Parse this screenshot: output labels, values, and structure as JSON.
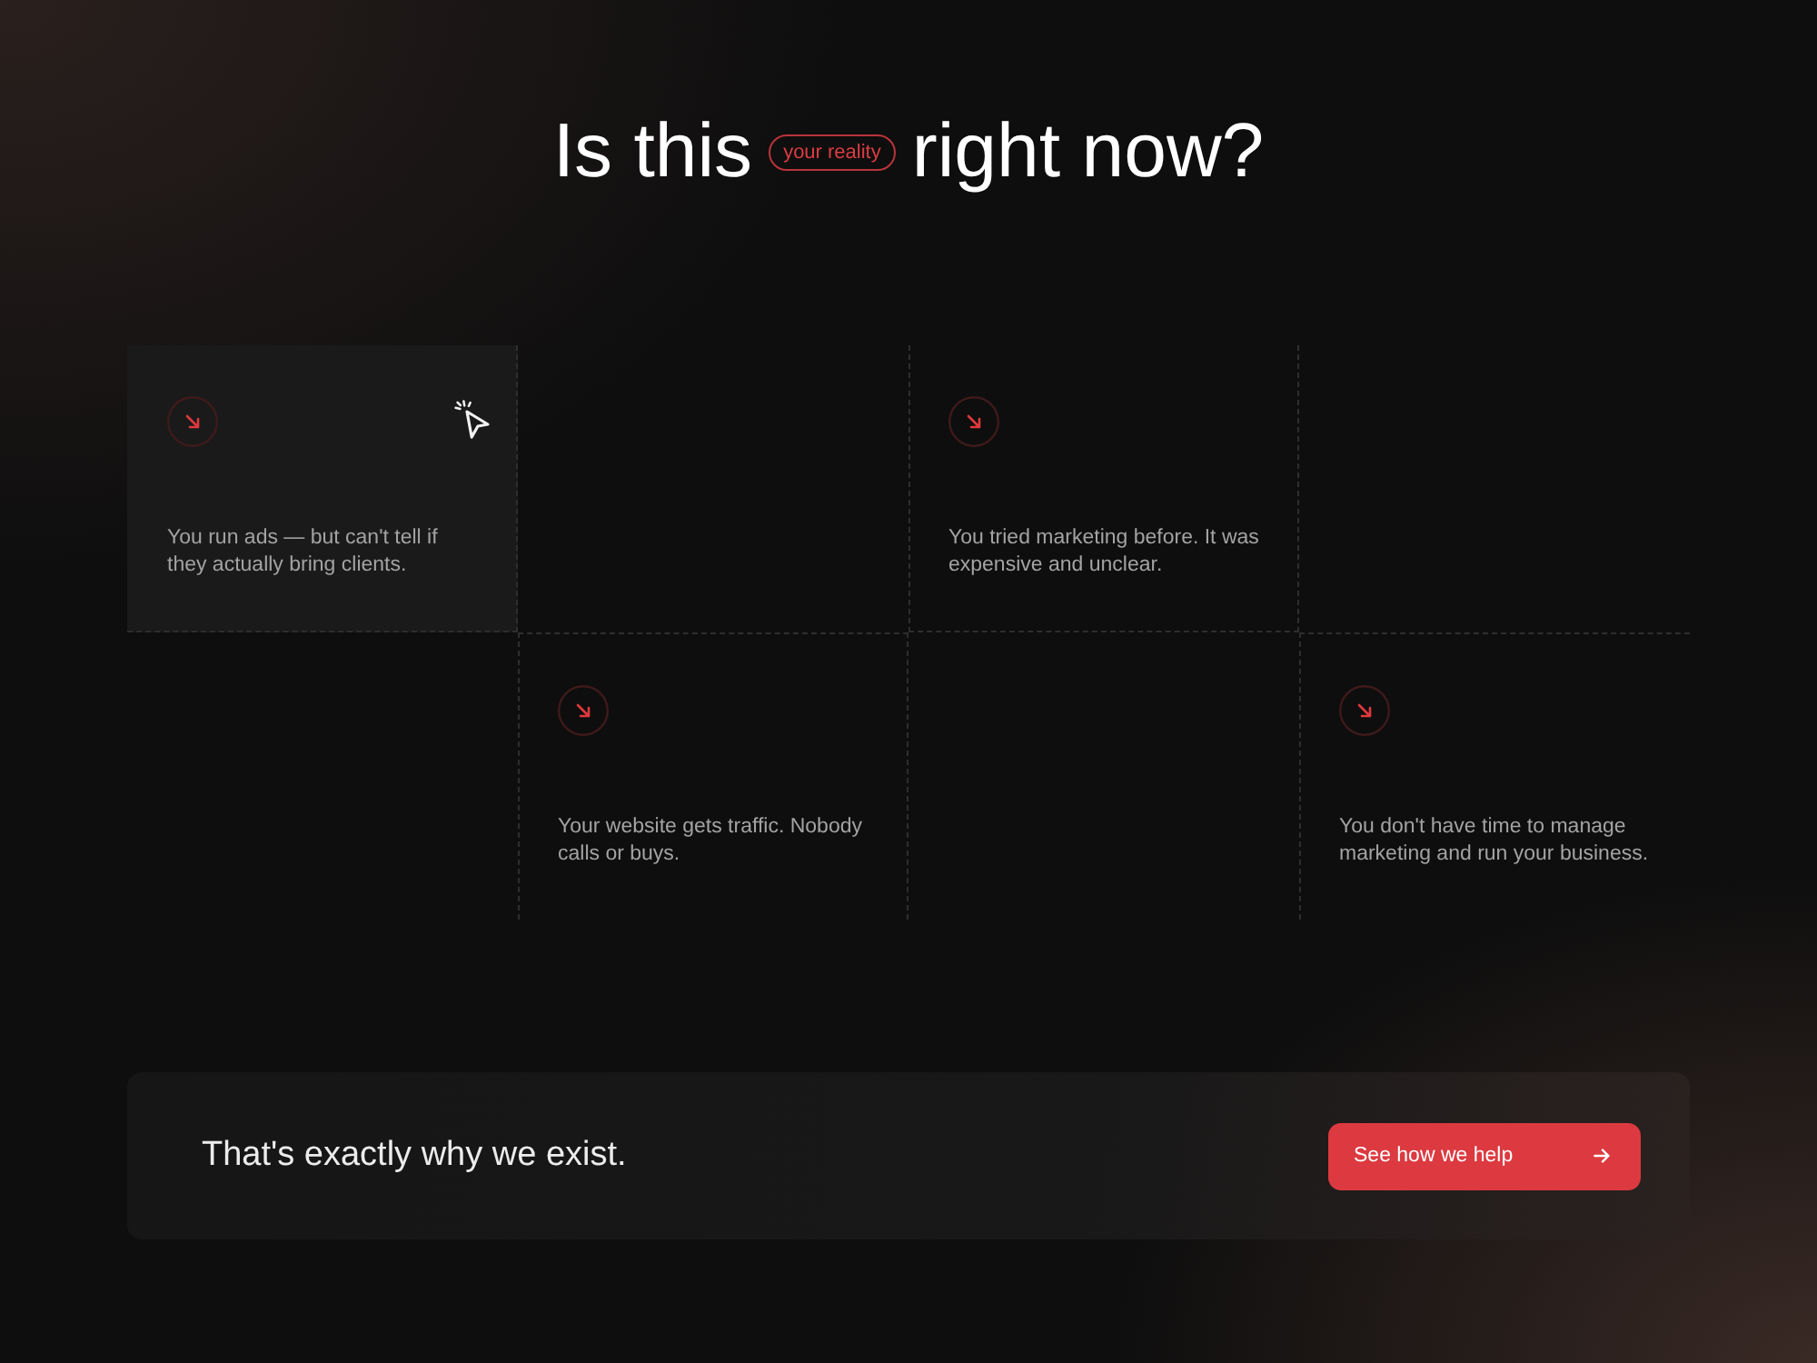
{
  "heading": {
    "before": "Is this",
    "badge": "your reality",
    "after": "right now?"
  },
  "cells": [
    {
      "kind": "problem",
      "text": "You run ads — but can't tell if they actually bring clients.",
      "highlighted": true
    },
    {
      "kind": "blank"
    },
    {
      "kind": "problem",
      "text": "You tried marketing before. It was expensive and unclear.",
      "highlighted": false
    },
    {
      "kind": "blank"
    },
    {
      "kind": "blank"
    },
    {
      "kind": "problem",
      "text": "Your website gets traffic. Nobody calls or buys.",
      "highlighted": false
    },
    {
      "kind": "blank"
    },
    {
      "kind": "problem",
      "text": "You don't have time to manage marketing and run your business.",
      "highlighted": false
    }
  ],
  "banner": {
    "text": "That's exactly why we exist.",
    "button": "See how we help"
  }
}
